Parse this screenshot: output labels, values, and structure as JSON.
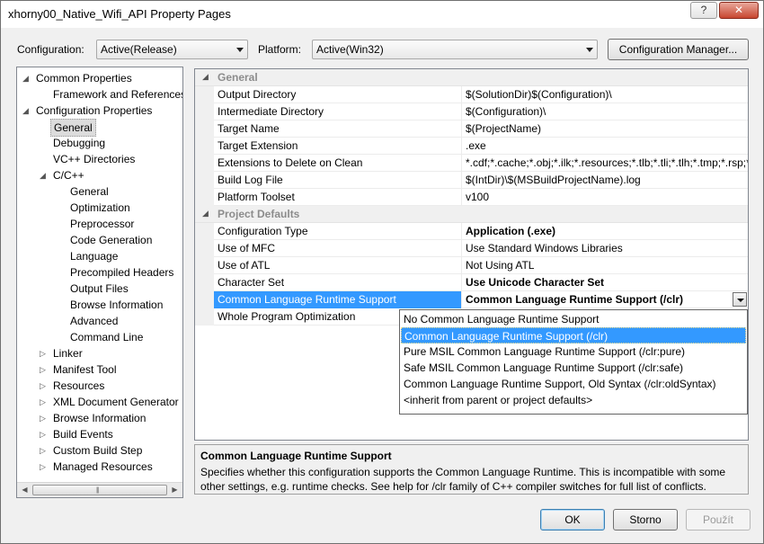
{
  "window": {
    "title": "xhorny00_Native_Wifi_API Property Pages",
    "help_button": "?",
    "close_button": "✕"
  },
  "toolbar": {
    "configuration_label": "Configuration:",
    "configuration_value": "Active(Release)",
    "platform_label": "Platform:",
    "platform_value": "Active(Win32)",
    "config_manager_button": "Configuration Manager..."
  },
  "tree": {
    "items": [
      {
        "label": "Common Properties",
        "expander": "◢"
      },
      {
        "label": "Framework and References"
      },
      {
        "label": "Configuration Properties",
        "expander": "◢"
      },
      {
        "label": "General"
      },
      {
        "label": "Debugging"
      },
      {
        "label": "VC++ Directories"
      },
      {
        "label": "C/C++",
        "expander": "◢"
      },
      {
        "label": "General"
      },
      {
        "label": "Optimization"
      },
      {
        "label": "Preprocessor"
      },
      {
        "label": "Code Generation"
      },
      {
        "label": "Language"
      },
      {
        "label": "Precompiled Headers"
      },
      {
        "label": "Output Files"
      },
      {
        "label": "Browse Information"
      },
      {
        "label": "Advanced"
      },
      {
        "label": "Command Line"
      },
      {
        "label": "Linker",
        "expander": "▷"
      },
      {
        "label": "Manifest Tool",
        "expander": "▷"
      },
      {
        "label": "Resources",
        "expander": "▷"
      },
      {
        "label": "XML Document Generator",
        "expander": "▷"
      },
      {
        "label": "Browse Information",
        "expander": "▷"
      },
      {
        "label": "Build Events",
        "expander": "▷"
      },
      {
        "label": "Custom Build Step",
        "expander": "▷"
      },
      {
        "label": "Managed Resources",
        "expander": "▷"
      }
    ],
    "scroll_left": "◀",
    "scroll_right": "▶",
    "scroll_grip": "|||"
  },
  "grid": {
    "rows": [
      {
        "kind": "cat",
        "name": "General",
        "expander": "◢"
      },
      {
        "name": "Output Directory",
        "value": "$(SolutionDir)$(Configuration)\\"
      },
      {
        "name": "Intermediate Directory",
        "value": "$(Configuration)\\"
      },
      {
        "name": "Target Name",
        "value": "$(ProjectName)"
      },
      {
        "name": "Target Extension",
        "value": ".exe"
      },
      {
        "name": "Extensions to Delete on Clean",
        "value": "*.cdf;*.cache;*.obj;*.ilk;*.resources;*.tlb;*.tli;*.tlh;*.tmp;*.rsp;*"
      },
      {
        "name": "Build Log File",
        "value": "$(IntDir)\\$(MSBuildProjectName).log"
      },
      {
        "name": "Platform Toolset",
        "value": "v100"
      },
      {
        "kind": "cat",
        "name": "Project Defaults",
        "expander": "◢"
      },
      {
        "name": "Configuration Type",
        "value": "Application (.exe)",
        "bold": true
      },
      {
        "name": "Use of MFC",
        "value": "Use Standard Windows Libraries"
      },
      {
        "name": "Use of ATL",
        "value": "Not Using ATL"
      },
      {
        "name": "Character Set",
        "value": "Use Unicode Character Set",
        "bold": true
      },
      {
        "name": "Common Language Runtime Support",
        "value": "Common Language Runtime Support (/clr)",
        "bold": true,
        "selected": true
      },
      {
        "name": "Whole Program Optimization",
        "value": ""
      }
    ]
  },
  "dropdown": {
    "options": [
      "No Common Language Runtime Support",
      "Common Language Runtime Support (/clr)",
      "Pure MSIL Common Language Runtime Support (/clr:pure)",
      "Safe MSIL Common Language Runtime Support (/clr:safe)",
      "Common Language Runtime Support, Old Syntax (/clr:oldSyntax)",
      "<inherit from parent or project defaults>"
    ],
    "selected_index": 1
  },
  "description": {
    "title": "Common Language Runtime Support",
    "text": "Specifies whether this configuration supports the Common Language Runtime. This is incompatible with some other settings, e.g. runtime checks. See help for /clr family of C++ compiler switches for full list of conflicts."
  },
  "buttons": {
    "ok": "OK",
    "cancel": "Storno",
    "apply": "Použít"
  }
}
